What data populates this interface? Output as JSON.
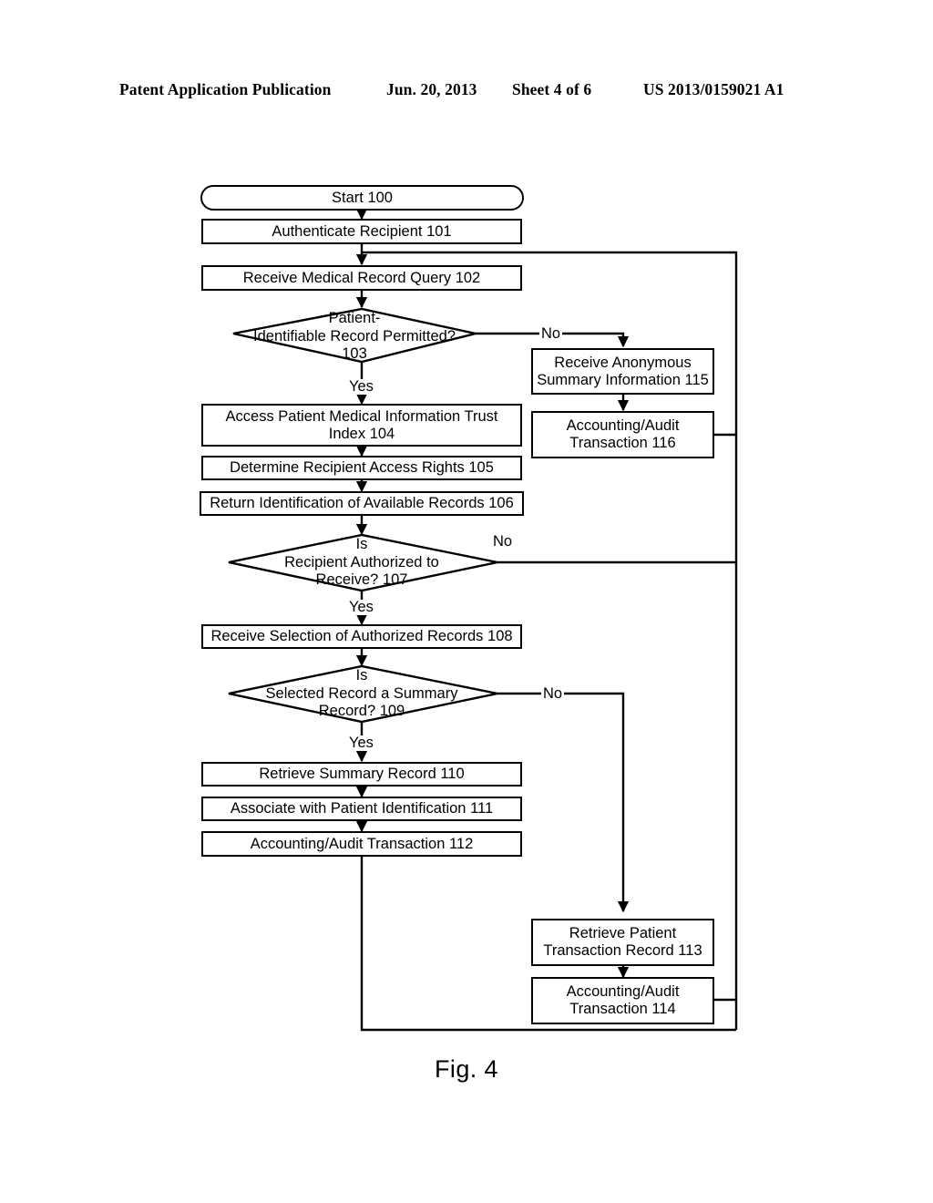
{
  "header": {
    "publication": "Patent Application Publication",
    "date": "Jun. 20, 2013",
    "sheet": "Sheet 4 of 6",
    "patent_number": "US 2013/0159021 A1"
  },
  "figure": {
    "caption": "Fig. 4"
  },
  "flowchart": {
    "nodes": [
      {
        "id": "n100",
        "ref": "100",
        "label": "Start 100",
        "shape": "terminator"
      },
      {
        "id": "n101",
        "ref": "101",
        "label": "Authenticate Recipient 101",
        "shape": "process"
      },
      {
        "id": "n102",
        "ref": "102",
        "label": "Receive Medical Record Query 102",
        "shape": "process"
      },
      {
        "id": "n103",
        "ref": "103",
        "label": "Patient-Identifiable Record Permitted? 103",
        "shape": "decision",
        "lines": [
          "Patient-",
          "Identifiable Record Permitted?",
          "103"
        ]
      },
      {
        "id": "n104",
        "ref": "104",
        "label": "Access Patient Medical Information Trust Index 104",
        "shape": "process",
        "lines": [
          "Access Patient Medical Information Trust",
          "Index 104"
        ]
      },
      {
        "id": "n105",
        "ref": "105",
        "label": "Determine Recipient Access Rights 105",
        "shape": "process"
      },
      {
        "id": "n106",
        "ref": "106",
        "label": "Return Identification of Available Records 106",
        "shape": "process"
      },
      {
        "id": "n107",
        "ref": "107",
        "label": "Is Recipient Authorized to Receive? 107",
        "shape": "decision",
        "lines": [
          "Is",
          "Recipient Authorized to",
          "Receive? 107"
        ]
      },
      {
        "id": "n108",
        "ref": "108",
        "label": "Receive Selection of Authorized Records 108",
        "shape": "process"
      },
      {
        "id": "n109",
        "ref": "109",
        "label": "Is Selected Record a Summary Record? 109",
        "shape": "decision",
        "lines": [
          "Is",
          "Selected Record a Summary",
          "Record? 109"
        ]
      },
      {
        "id": "n110",
        "ref": "110",
        "label": "Retrieve Summary Record 110",
        "shape": "process"
      },
      {
        "id": "n111",
        "ref": "111",
        "label": "Associate with Patient Identification 111",
        "shape": "process"
      },
      {
        "id": "n112",
        "ref": "112",
        "label": "Accounting/Audit Transaction 112",
        "shape": "process"
      },
      {
        "id": "n113",
        "ref": "113",
        "label": "Retrieve Patient Transaction Record 113",
        "shape": "process",
        "lines": [
          "Retrieve Patient",
          "Transaction Record 113"
        ]
      },
      {
        "id": "n114",
        "ref": "114",
        "label": "Accounting/Audit Transaction 114",
        "shape": "process",
        "lines": [
          "Accounting/Audit",
          "Transaction 114"
        ]
      },
      {
        "id": "n115",
        "ref": "115",
        "label": "Receive Anonymous Summary Information 115",
        "shape": "process",
        "lines": [
          "Receive Anonymous",
          "Summary Information 115"
        ]
      },
      {
        "id": "n116",
        "ref": "116",
        "label": "Accounting/Audit Transaction 116",
        "shape": "process",
        "lines": [
          "Accounting/Audit",
          "Transaction 116"
        ]
      }
    ],
    "edge_labels": {
      "e103_no": "No",
      "e103_yes": "Yes",
      "e107_no": "No",
      "e107_yes": "Yes",
      "e109_no": "No",
      "e109_yes": "Yes"
    },
    "colors": {
      "stroke": "#000000",
      "fill": "#ffffff",
      "text": "#000000"
    }
  }
}
